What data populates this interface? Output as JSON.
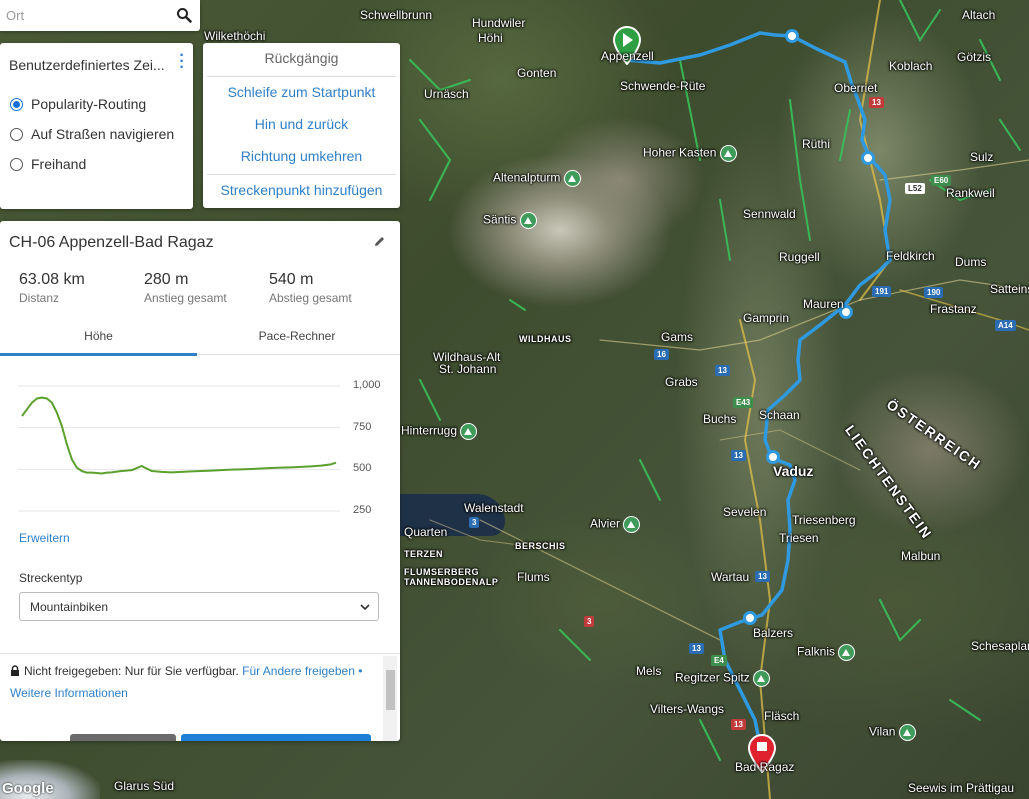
{
  "search": {
    "placeholder": "Ort",
    "icon": "search-icon"
  },
  "routing": {
    "title": "Benutzerdefiniertes Zei...",
    "options": [
      {
        "label": "Popularity-Routing",
        "selected": true
      },
      {
        "label": "Auf Straßen navigieren",
        "selected": false
      },
      {
        "label": "Freihand",
        "selected": false
      }
    ]
  },
  "menu": {
    "items": [
      "Rückgängig",
      "Schleife zum Startpunkt",
      "Hin und zurück",
      "Richtung umkehren",
      "Streckenpunkt hinzufügen"
    ]
  },
  "route": {
    "name": "CH-06 Appenzell-Bad Ragaz",
    "stats": [
      {
        "value": "63.08 km",
        "label": "Distanz"
      },
      {
        "value": "280 m",
        "label": "Anstieg gesamt"
      },
      {
        "value": "540 m",
        "label": "Abstieg gesamt"
      }
    ],
    "tabs": [
      "Höhe",
      "Pace-Rechner"
    ],
    "active_tab": "Höhe",
    "elevation_ticks": [
      "1,000",
      "750",
      "500",
      "250"
    ],
    "expand_link": "Erweitern",
    "route_type_label": "Streckentyp",
    "route_type_value": "Mountainbiken",
    "privacy_text": "Nicht freigegeben: Nur für Sie verfügbar.",
    "share_link": "Für Andere freigeben",
    "bullet": "•",
    "more_info_link": "Weitere Informationen"
  },
  "chart_data": {
    "type": "line",
    "ylim": [
      250,
      1000
    ],
    "yticks": [
      1000,
      750,
      500,
      250
    ],
    "x": [
      0,
      1,
      2,
      3,
      4,
      5,
      6,
      7,
      8,
      9,
      10,
      11,
      12,
      13,
      14,
      15,
      16,
      17,
      18,
      19,
      20,
      22,
      24,
      26,
      28,
      30,
      32,
      34,
      36,
      38,
      40,
      42,
      44,
      46,
      48,
      50,
      52,
      54,
      56,
      58,
      60,
      62,
      63
    ],
    "series": [
      {
        "values": [
          820,
          860,
          900,
          925,
          930,
          925,
          900,
          840,
          760,
          650,
          560,
          510,
          490,
          480,
          480,
          478,
          475,
          480,
          482,
          486,
          490,
          495,
          520,
          490,
          485,
          482,
          485,
          488,
          490,
          492,
          495,
          498,
          500,
          502,
          505,
          508,
          510,
          512,
          515,
          518,
          522,
          530,
          540
        ]
      }
    ]
  },
  "map": {
    "towns": [
      "Schwellbrunn",
      "Altach",
      "Wilkethöchi",
      "Hundwiler",
      "Höhi",
      "Koblach",
      "Götzis",
      "Appenzell",
      "Gonten",
      "Schwende-Rüte",
      "Oberriet",
      "Urnäsch",
      "Rüthi",
      "Sulz",
      "Hoher Kasten",
      "Rankweil",
      "Altenalpturm",
      "Säntis",
      "Sennwald",
      "Feldkirch",
      "Dums",
      "Ruggell",
      "Satteins",
      "Mauren",
      "Frastanz",
      "Gamprin",
      "Gams",
      "Wildhaus-Alt",
      "St. Johann",
      "Grabs",
      "Buchs",
      "Schaan",
      "Hinterrugg",
      "Vaduz",
      "Walenstadt",
      "Sevelen",
      "Triesenberg",
      "Alvier",
      "Triesen",
      "Malbun",
      "Flums",
      "Wartau",
      "Balzers",
      "Schesaplana",
      "Mels",
      "Falknis",
      "Regitzer Spitz",
      "Vilters-Wangs",
      "Fläsch",
      "Vilan",
      "Bad Ragaz",
      "Glarus Süd",
      "Seewis im Prättigau",
      "Quarten"
    ],
    "regions": [
      "WILDHAUS",
      "BERSCHIS",
      "FLUMSERBERG TANNENBODENALP",
      "TERZEN"
    ],
    "countries": [
      "ÖSTERREICH",
      "LIECHTENSTEIN"
    ],
    "road_shields": [
      "13",
      "E60",
      "L52",
      "191",
      "190",
      "A14",
      "16",
      "13",
      "E43",
      "13",
      "3",
      "13",
      "3",
      "13",
      "E4",
      "13"
    ],
    "provider": "Google"
  },
  "colors": {
    "route": "#2f9ae0",
    "accent": "#2f80c8",
    "start": "#2ea043",
    "end": "#e0222f",
    "elevation": "#5aa02c"
  }
}
